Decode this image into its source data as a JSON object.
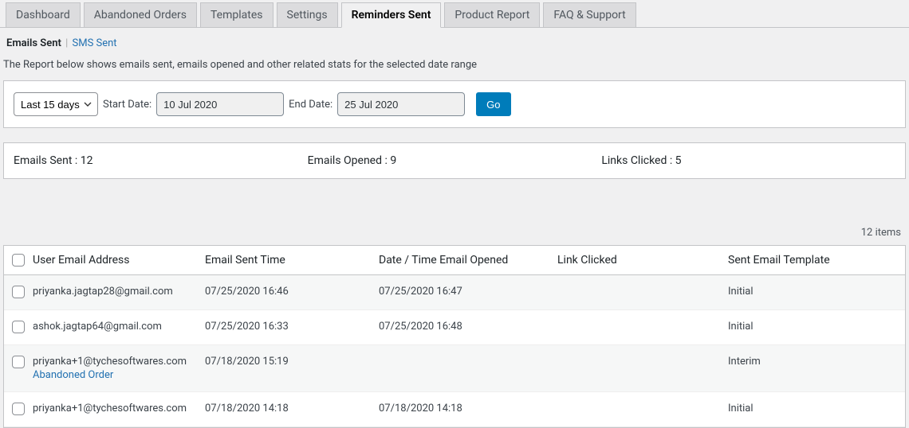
{
  "tabs": [
    {
      "label": "Dashboard",
      "active": false
    },
    {
      "label": "Abandoned Orders",
      "active": false
    },
    {
      "label": "Templates",
      "active": false
    },
    {
      "label": "Settings",
      "active": false
    },
    {
      "label": "Reminders Sent",
      "active": true
    },
    {
      "label": "Product Report",
      "active": false
    },
    {
      "label": "FAQ & Support",
      "active": false
    }
  ],
  "subtabs": {
    "emails_sent": "Emails Sent",
    "sms_sent": "SMS Sent"
  },
  "description": "The Report below shows emails sent, emails opened and other related stats for the selected date range",
  "filter": {
    "range_selected": "Last 15 days",
    "start_label": "Start Date:",
    "start_value": "10 Jul 2020",
    "end_label": "End Date:",
    "end_value": "25 Jul 2020",
    "go": "Go"
  },
  "stats": {
    "sent": "Emails Sent : 12",
    "opened": "Emails Opened : 9",
    "clicked": "Links Clicked : 5"
  },
  "items_count": "12 items",
  "columns": {
    "email": "User Email Address",
    "sent": "Email Sent Time",
    "opened": "Date / Time Email Opened",
    "link": "Link Clicked",
    "template": "Sent Email Template"
  },
  "rows": [
    {
      "email": "priyanka.jagtap28@gmail.com",
      "sent": "07/25/2020 16:46",
      "opened": "07/25/2020 16:47",
      "link": "",
      "template": "Initial",
      "sublink": ""
    },
    {
      "email": "ashok.jagtap64@gmail.com",
      "sent": "07/25/2020 16:33",
      "opened": "07/25/2020 16:48",
      "link": "",
      "template": "Initial",
      "sublink": ""
    },
    {
      "email": "priyanka+1@tychesoftwares.com",
      "sent": "07/18/2020 15:19",
      "opened": "",
      "link": "",
      "template": "Interim",
      "sublink": "Abandoned Order"
    },
    {
      "email": "priyanka+1@tychesoftwares.com",
      "sent": "07/18/2020 14:18",
      "opened": "07/18/2020 14:18",
      "link": "",
      "template": "Initial",
      "sublink": ""
    }
  ]
}
